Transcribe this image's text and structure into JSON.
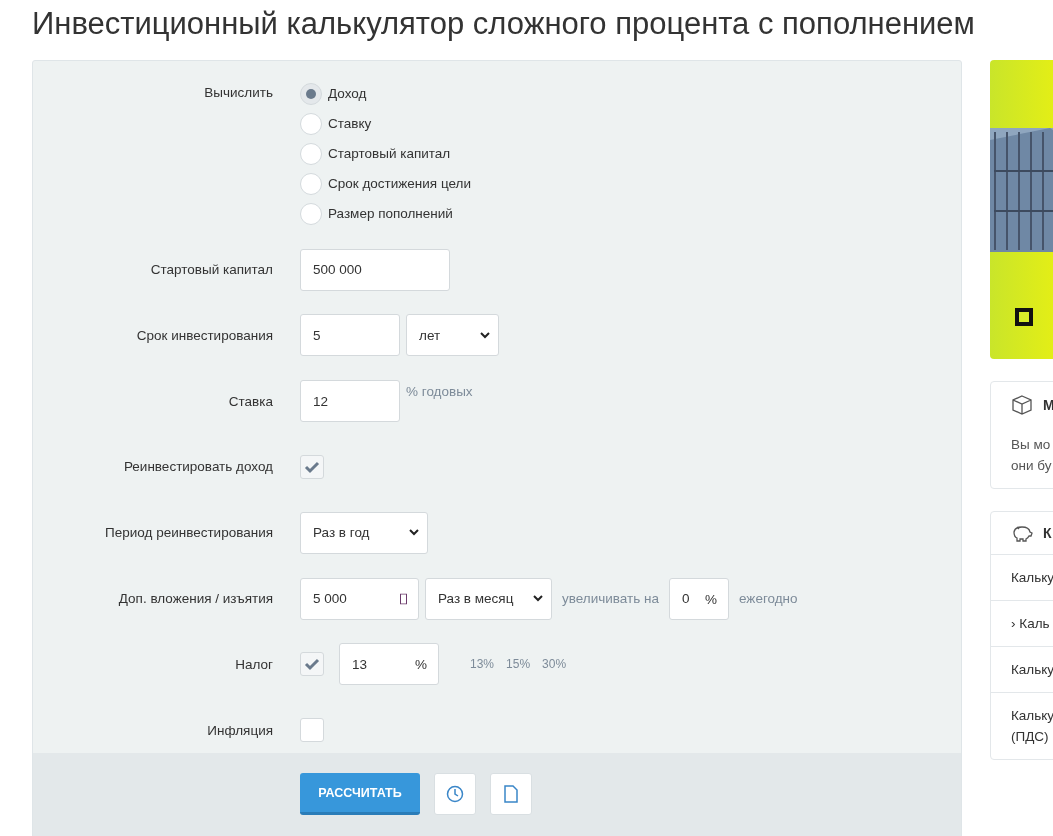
{
  "title": "Инвестиционный калькулятор сложного процента с пополнением",
  "calculate": {
    "label": "Вычислить",
    "options": [
      {
        "label": "Доход",
        "selected": true
      },
      {
        "label": "Ставку",
        "selected": false
      },
      {
        "label": "Стартовый капитал",
        "selected": false
      },
      {
        "label": "Срок достижения цели",
        "selected": false
      },
      {
        "label": "Размер пополнений",
        "selected": false
      }
    ]
  },
  "start_capital": {
    "label": "Стартовый капитал",
    "value": "500 000"
  },
  "term": {
    "label": "Срок инвестирования",
    "value": "5",
    "unit": "лет"
  },
  "rate": {
    "label": "Ставка",
    "value": "12",
    "suffix": "% годовых"
  },
  "reinvest": {
    "label": "Реинвестировать доход",
    "checked": true
  },
  "reinvest_period": {
    "label": "Период реинвестирования",
    "value": "Раз в год"
  },
  "contributions": {
    "label": "Доп. вложения / изъятия",
    "value": "5 000",
    "frequency": "Раз в месяц",
    "increase_label": "увеличивать на",
    "increase_value": "0",
    "increase_unit": "%",
    "increase_suffix": "ежегодно"
  },
  "tax": {
    "label": "Налог",
    "checked": true,
    "value": "13",
    "unit": "%",
    "presets": [
      "13%",
      "15%",
      "30%"
    ]
  },
  "inflation": {
    "label": "Инфляция",
    "checked": false
  },
  "actions": {
    "calculate": "РАССЧИТАТЬ"
  },
  "sidebar": {
    "cards": [
      {
        "title": "М",
        "body": [
          "Вы мо",
          "они бу"
        ]
      },
      {
        "title": "К",
        "items": [
          {
            "label": "Кальку"
          },
          {
            "marker": "›",
            "label": "Каль"
          },
          {
            "label": "Кальку"
          },
          {
            "label": "Кальку (ПДС)"
          }
        ]
      }
    ]
  }
}
